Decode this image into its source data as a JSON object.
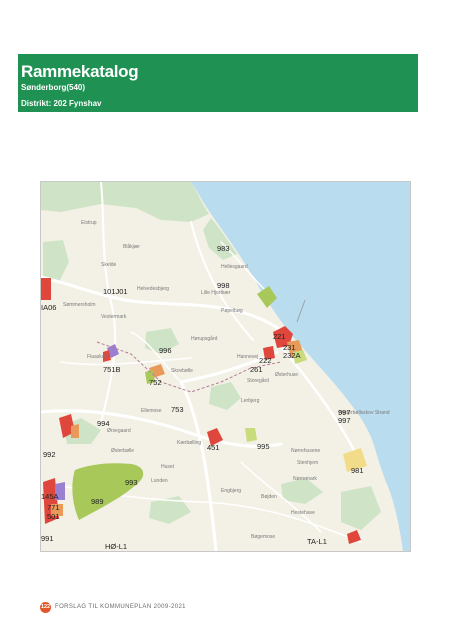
{
  "header": {
    "title": "Rammekatalog",
    "municipality": "Sønderborg(540)",
    "district": "Distrikt: 202 Fynshav"
  },
  "map": {
    "colors": {
      "sea": "#b9dcef",
      "land": "#f3f1e6",
      "road": "#ffffff",
      "forest": "#cfe4c6",
      "urban_red": "#e0473c",
      "residential_orange": "#e89a5a",
      "summerhouse_green": "#a8c85a",
      "recreation_light_green": "#c8dc7c",
      "holiday_yellow": "#f2dc8a",
      "purple_zone": "#9b7fd0"
    },
    "zone_labels": [
      "983",
      "998",
      "101J01",
      "IA06",
      "221",
      "231",
      "232A",
      "222",
      "261",
      "996",
      "751B",
      "752",
      "753",
      "994",
      "997",
      "997",
      "992",
      "451",
      "995",
      "981",
      "993",
      "989",
      "145A",
      "771",
      "501",
      "991",
      "HØ-L1",
      "TA-L1"
    ],
    "place_names": [
      "Bøjden",
      "Helvedesbjerg",
      "Hannevej",
      "Lille Hjortkær",
      "Nederbøllsskov Strand",
      "Elstrup",
      "Skelde",
      "Blåkjær",
      "Sømmersholm",
      "Pøpelbøg",
      "Hørupsgård",
      "Storegård",
      "Ørsegaard",
      "Huset",
      "Stenhjem",
      "Lerbjerg",
      "Nørremark",
      "Skovbølle",
      "Hellesgaard",
      "Ellemose",
      "Kærbølling",
      "Østerhuse",
      "Østerbølle",
      "Nørrehusene",
      "Vestermark",
      "Flaaskov",
      "Engbjerg",
      "Bøgemose",
      "Hestehave",
      "Lunden"
    ]
  },
  "footer": {
    "page_number": "122",
    "text": "FORSLAG TIL KOMMUNEPLAN 2009-2021"
  }
}
